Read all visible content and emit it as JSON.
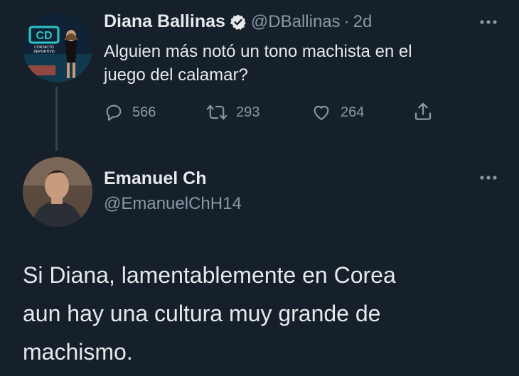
{
  "tweet": {
    "author_name": "Diana Ballinas",
    "author_handle": "@DBallinas",
    "separator": "·",
    "time_ago": "2d",
    "text_line1": "Alguien más notó un tono machista en el",
    "text_line2": "juego del calamar?",
    "replies": "566",
    "retweets": "293",
    "likes": "264",
    "avatar_logo": "CD",
    "avatar_logo_sub": "CONTACTO DEPORTIVO"
  },
  "reply": {
    "author_name": "Emanuel Ch",
    "author_handle": "@EmanuelChH14",
    "text_line1": "Si Diana, lamentablemente en Corea",
    "text_line2": "aun hay una cultura muy grande de",
    "text_line3": "machismo."
  },
  "icons": {
    "verified": "verified-badge-icon",
    "reply": "reply-icon",
    "retweet": "retweet-icon",
    "like": "heart-icon",
    "share": "share-icon",
    "more": "more-icon"
  },
  "colors": {
    "background": "#15202b",
    "text": "#e7e9ea",
    "secondary": "#8b98a5"
  }
}
